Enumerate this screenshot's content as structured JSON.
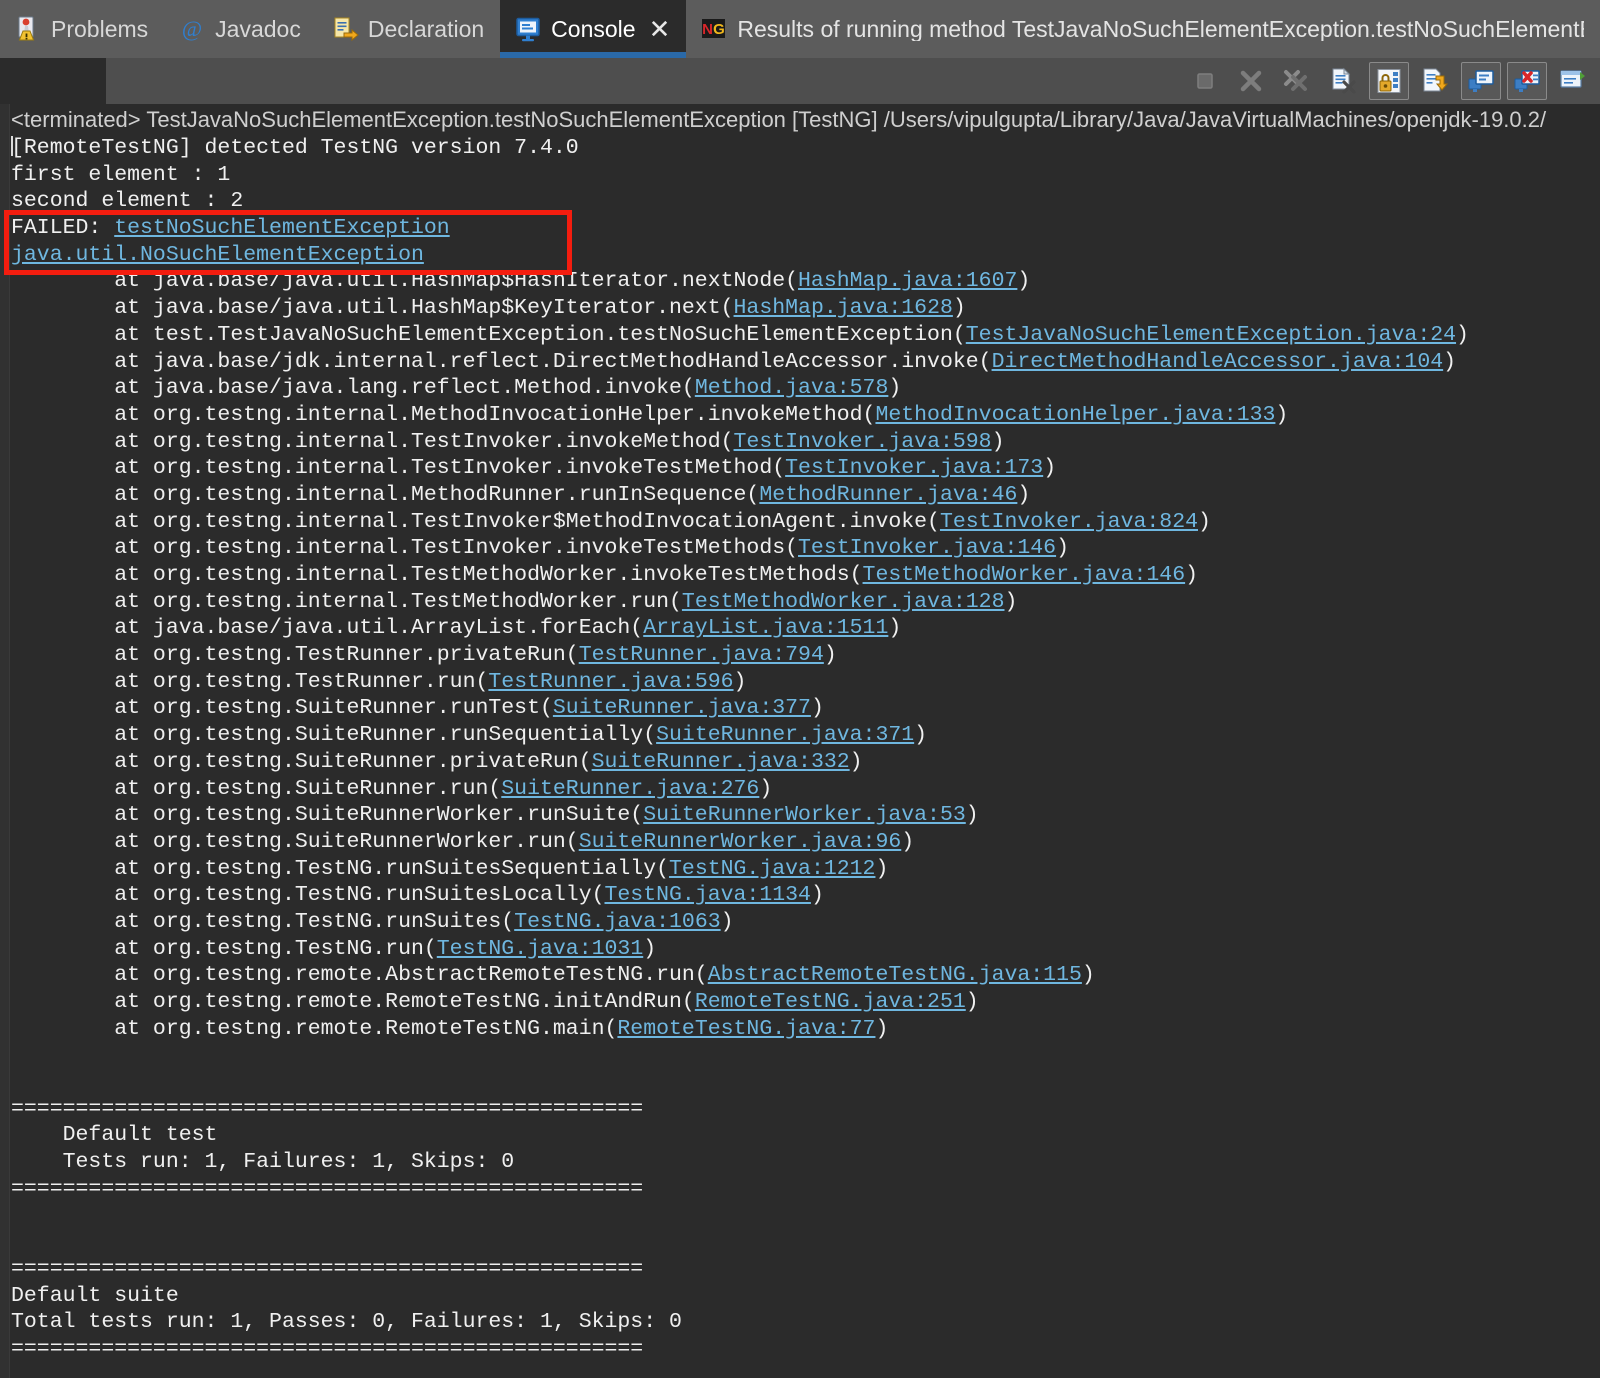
{
  "window": {
    "background": "#2b2b2b",
    "link_color": "#6fb7e0",
    "accent_color": "#2a69a8",
    "annotation_color": "#f41d0f"
  },
  "tabs": [
    {
      "label": "Problems",
      "icon": "problems-warning-icon",
      "active": false,
      "closable": false
    },
    {
      "label": "Javadoc",
      "icon": "javadoc-at-icon",
      "active": false,
      "closable": false
    },
    {
      "label": "Declaration",
      "icon": "declaration-icon",
      "active": false,
      "closable": false
    },
    {
      "label": "Console",
      "icon": "console-monitor-icon",
      "active": true,
      "closable": true,
      "close_glyph": "✕"
    },
    {
      "label": "Results of running method TestJavaNoSuchElementException.testNoSuchElementExcepti",
      "icon": "testng-icon",
      "active": false,
      "closable": false
    }
  ],
  "toolbar": {
    "buttons": [
      {
        "name": "terminate-button",
        "icon": "stop-square-icon",
        "framed": false,
        "enabled": false
      },
      {
        "name": "remove-launch-button",
        "icon": "close-x-icon",
        "framed": false,
        "enabled": false
      },
      {
        "name": "remove-all-terminated-button",
        "icon": "close-all-xx-icon",
        "framed": false,
        "enabled": false
      },
      {
        "name": "clear-console-button",
        "icon": "clear-console-icon",
        "framed": false,
        "enabled": true
      },
      {
        "name": "scroll-lock-button",
        "icon": "scroll-lock-padlock-icon",
        "framed": true,
        "enabled": true
      },
      {
        "name": "word-wrap-button",
        "icon": "word-wrap-icon",
        "framed": false,
        "enabled": true
      },
      {
        "name": "show-console-on-output-button",
        "icon": "display-selected-console-icon",
        "framed": true,
        "enabled": true
      },
      {
        "name": "show-console-on-error-button",
        "icon": "display-console-error-icon",
        "framed": true,
        "enabled": true
      },
      {
        "name": "open-console-button",
        "icon": "open-console-dropdown-icon",
        "framed": false,
        "enabled": true
      }
    ]
  },
  "console": {
    "launch_line": "<terminated> TestJavaNoSuchElementException.testNoSuchElementException [TestNG] /Users/vipulgupta/Library/Java/JavaVirtualMachines/openjdk-19.0.2/",
    "lines": [
      {
        "type": "plain",
        "text": "[RemoteTestNG] detected TestNG version 7.4.0",
        "caret": true
      },
      {
        "type": "plain",
        "text": "first element : 1"
      },
      {
        "type": "plain",
        "text": "second element : 2"
      },
      {
        "type": "mixed",
        "pre": "FAILED: ",
        "link": "testNoSuchElementException",
        "post": ""
      },
      {
        "type": "mixed",
        "pre": "",
        "link": "java.util.NoSuchElementException",
        "post": ""
      },
      {
        "type": "frame",
        "pre": "\tat java.base/java.util.HashMap$HashIterator.nextNode(",
        "link": "HashMap.java:1607",
        "post": ")"
      },
      {
        "type": "frame",
        "pre": "\tat java.base/java.util.HashMap$KeyIterator.next(",
        "link": "HashMap.java:1628",
        "post": ")"
      },
      {
        "type": "frame",
        "pre": "\tat test.TestJavaNoSuchElementException.testNoSuchElementException(",
        "link": "TestJavaNoSuchElementException.java:24",
        "post": ")"
      },
      {
        "type": "frame",
        "pre": "\tat java.base/jdk.internal.reflect.DirectMethodHandleAccessor.invoke(",
        "link": "DirectMethodHandleAccessor.java:104",
        "post": ")"
      },
      {
        "type": "frame",
        "pre": "\tat java.base/java.lang.reflect.Method.invoke(",
        "link": "Method.java:578",
        "post": ")"
      },
      {
        "type": "frame",
        "pre": "\tat org.testng.internal.MethodInvocationHelper.invokeMethod(",
        "link": "MethodInvocationHelper.java:133",
        "post": ")"
      },
      {
        "type": "frame",
        "pre": "\tat org.testng.internal.TestInvoker.invokeMethod(",
        "link": "TestInvoker.java:598",
        "post": ")"
      },
      {
        "type": "frame",
        "pre": "\tat org.testng.internal.TestInvoker.invokeTestMethod(",
        "link": "TestInvoker.java:173",
        "post": ")"
      },
      {
        "type": "frame",
        "pre": "\tat org.testng.internal.MethodRunner.runInSequence(",
        "link": "MethodRunner.java:46",
        "post": ")"
      },
      {
        "type": "frame",
        "pre": "\tat org.testng.internal.TestInvoker$MethodInvocationAgent.invoke(",
        "link": "TestInvoker.java:824",
        "post": ")"
      },
      {
        "type": "frame",
        "pre": "\tat org.testng.internal.TestInvoker.invokeTestMethods(",
        "link": "TestInvoker.java:146",
        "post": ")"
      },
      {
        "type": "frame",
        "pre": "\tat org.testng.internal.TestMethodWorker.invokeTestMethods(",
        "link": "TestMethodWorker.java:146",
        "post": ")"
      },
      {
        "type": "frame",
        "pre": "\tat org.testng.internal.TestMethodWorker.run(",
        "link": "TestMethodWorker.java:128",
        "post": ")"
      },
      {
        "type": "frame",
        "pre": "\tat java.base/java.util.ArrayList.forEach(",
        "link": "ArrayList.java:1511",
        "post": ")"
      },
      {
        "type": "frame",
        "pre": "\tat org.testng.TestRunner.privateRun(",
        "link": "TestRunner.java:794",
        "post": ")"
      },
      {
        "type": "frame",
        "pre": "\tat org.testng.TestRunner.run(",
        "link": "TestRunner.java:596",
        "post": ")"
      },
      {
        "type": "frame",
        "pre": "\tat org.testng.SuiteRunner.runTest(",
        "link": "SuiteRunner.java:377",
        "post": ")"
      },
      {
        "type": "frame",
        "pre": "\tat org.testng.SuiteRunner.runSequentially(",
        "link": "SuiteRunner.java:371",
        "post": ")"
      },
      {
        "type": "frame",
        "pre": "\tat org.testng.SuiteRunner.privateRun(",
        "link": "SuiteRunner.java:332",
        "post": ")"
      },
      {
        "type": "frame",
        "pre": "\tat org.testng.SuiteRunner.run(",
        "link": "SuiteRunner.java:276",
        "post": ")"
      },
      {
        "type": "frame",
        "pre": "\tat org.testng.SuiteRunnerWorker.runSuite(",
        "link": "SuiteRunnerWorker.java:53",
        "post": ")"
      },
      {
        "type": "frame",
        "pre": "\tat org.testng.SuiteRunnerWorker.run(",
        "link": "SuiteRunnerWorker.java:96",
        "post": ")"
      },
      {
        "type": "frame",
        "pre": "\tat org.testng.TestNG.runSuitesSequentially(",
        "link": "TestNG.java:1212",
        "post": ")"
      },
      {
        "type": "frame",
        "pre": "\tat org.testng.TestNG.runSuitesLocally(",
        "link": "TestNG.java:1134",
        "post": ")"
      },
      {
        "type": "frame",
        "pre": "\tat org.testng.TestNG.runSuites(",
        "link": "TestNG.java:1063",
        "post": ")"
      },
      {
        "type": "frame",
        "pre": "\tat org.testng.TestNG.run(",
        "link": "TestNG.java:1031",
        "post": ")"
      },
      {
        "type": "frame",
        "pre": "\tat org.testng.remote.AbstractRemoteTestNG.run(",
        "link": "AbstractRemoteTestNG.java:115",
        "post": ")"
      },
      {
        "type": "frame",
        "pre": "\tat org.testng.remote.RemoteTestNG.initAndRun(",
        "link": "RemoteTestNG.java:251",
        "post": ")"
      },
      {
        "type": "frame",
        "pre": "\tat org.testng.remote.RemoteTestNG.main(",
        "link": "RemoteTestNG.java:77",
        "post": ")"
      },
      {
        "type": "plain",
        "text": ""
      },
      {
        "type": "plain",
        "text": ""
      },
      {
        "type": "plain",
        "text": "================================================="
      },
      {
        "type": "plain",
        "text": "    Default test"
      },
      {
        "type": "plain",
        "text": "    Tests run: 1, Failures: 1, Skips: 0"
      },
      {
        "type": "plain",
        "text": "================================================="
      },
      {
        "type": "plain",
        "text": ""
      },
      {
        "type": "plain",
        "text": ""
      },
      {
        "type": "plain",
        "text": "================================================="
      },
      {
        "type": "plain",
        "text": "Default suite"
      },
      {
        "type": "plain",
        "text": "Total tests run: 1, Passes: 0, Failures: 1, Skips: 0"
      },
      {
        "type": "plain",
        "text": "================================================="
      }
    ]
  },
  "annotation": {
    "type": "red-rectangle",
    "targets": [
      "FAILED: testNoSuchElementException",
      "java.util.NoSuchElementException"
    ]
  }
}
